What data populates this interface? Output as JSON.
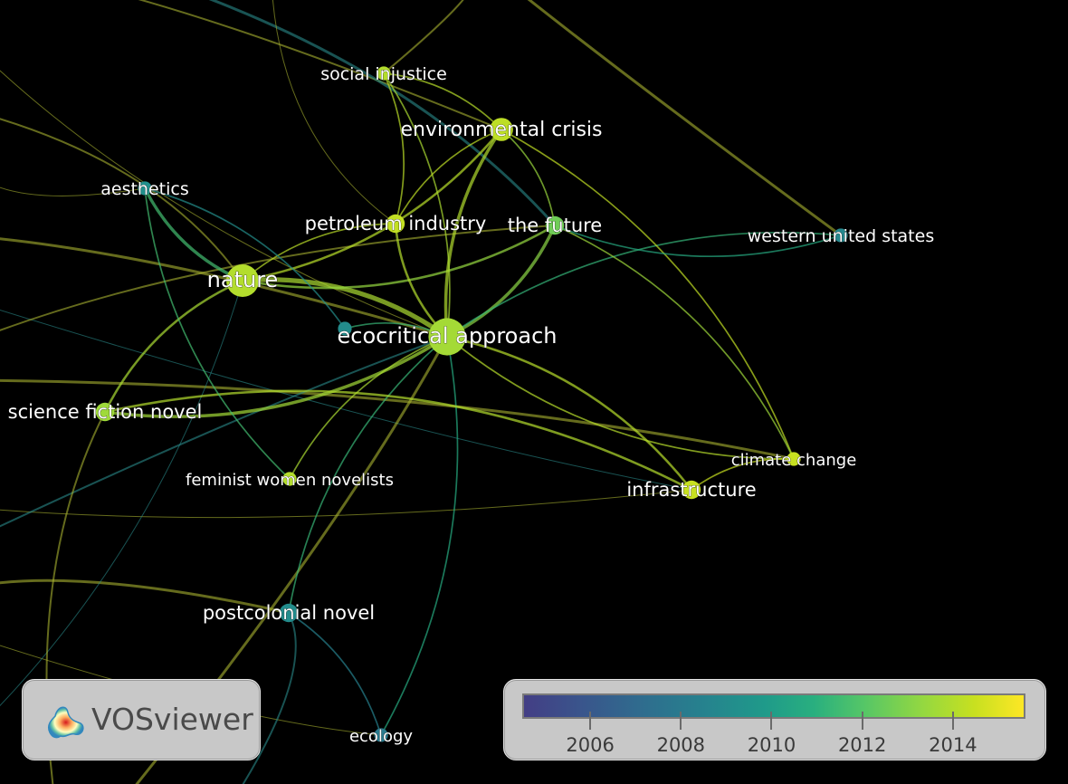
{
  "app": {
    "logo_text": "VOSviewer"
  },
  "network": {
    "nodes": [
      {
        "id": "social-injustice",
        "label": "social injustice",
        "year": 2014.6,
        "weight": 1
      },
      {
        "id": "environmental-crisis",
        "label": "environmental crisis",
        "year": 2014.8,
        "weight": 3
      },
      {
        "id": "aesthetics",
        "label": "aesthetics",
        "year": 2010.6,
        "weight": 1
      },
      {
        "id": "petroleum-industry",
        "label": "petroleum industry",
        "year": 2014.9,
        "weight": 2
      },
      {
        "id": "the-future",
        "label": "the future",
        "year": 2013.4,
        "weight": 2
      },
      {
        "id": "western-united-states",
        "label": "western united states",
        "year": 2010.2,
        "weight": 1
      },
      {
        "id": "nature",
        "label": "nature",
        "year": 2014.6,
        "weight": 5
      },
      {
        "id": "ecocritical-approach",
        "label": "ecocritical approach",
        "year": 2014.3,
        "weight": 6
      },
      {
        "id": "science-fiction-novel",
        "label": "science fiction novel",
        "year": 2014.2,
        "weight": 2
      },
      {
        "id": "feminist-women-novelists",
        "label": "feminist women novelists",
        "year": 2014.6,
        "weight": 1
      },
      {
        "id": "climate-change",
        "label": "climate change",
        "year": 2015.0,
        "weight": 1
      },
      {
        "id": "infrastructure",
        "label": "infrastructure",
        "year": 2015.0,
        "weight": 2
      },
      {
        "id": "postcolonial-novel",
        "label": "postcolonial novel",
        "year": 2010.4,
        "weight": 2
      },
      {
        "id": "ecology",
        "label": "ecology",
        "year": 2009.4,
        "weight": 1
      },
      {
        "id": "unlabeled-node",
        "label": "",
        "year": 2010.4,
        "weight": 1
      }
    ],
    "links": [
      [
        "nature",
        "ecocritical-approach",
        5
      ],
      [
        "nature",
        "environmental-crisis",
        2
      ],
      [
        "nature",
        "aesthetics",
        3
      ],
      [
        "nature",
        "the-future",
        2
      ],
      [
        "nature",
        "petroleum-industry",
        1
      ],
      [
        "nature",
        "science-fiction-novel",
        2
      ],
      [
        "ecocritical-approach",
        "environmental-crisis",
        3
      ],
      [
        "ecocritical-approach",
        "the-future",
        3
      ],
      [
        "ecocritical-approach",
        "petroleum-industry",
        2
      ],
      [
        "ecocritical-approach",
        "social-injustice",
        1
      ],
      [
        "ecocritical-approach",
        "science-fiction-novel",
        3
      ],
      [
        "ecocritical-approach",
        "feminist-women-novelists",
        1
      ],
      [
        "ecocritical-approach",
        "infrastructure",
        2
      ],
      [
        "ecocritical-approach",
        "climate-change",
        1
      ],
      [
        "ecocritical-approach",
        "western-united-states",
        1
      ],
      [
        "ecocritical-approach",
        "postcolonial-novel",
        1
      ],
      [
        "ecocritical-approach",
        "ecology",
        1
      ],
      [
        "ecocritical-approach",
        "unlabeled-node",
        1
      ],
      [
        "environmental-crisis",
        "climate-change",
        1
      ],
      [
        "environmental-crisis",
        "petroleum-industry",
        1
      ],
      [
        "environmental-crisis",
        "the-future",
        1
      ],
      [
        "environmental-crisis",
        "social-injustice",
        1
      ],
      [
        "the-future",
        "climate-change",
        1
      ],
      [
        "the-future",
        "western-united-states",
        1
      ],
      [
        "infrastructure",
        "climate-change",
        1
      ],
      [
        "infrastructure",
        "science-fiction-novel",
        2
      ],
      [
        "postcolonial-novel",
        "ecology",
        1
      ],
      [
        "aesthetics",
        "feminist-women-novelists",
        1
      ],
      [
        "aesthetics",
        "unlabeled-node",
        1
      ],
      [
        "petroleum-industry",
        "social-injustice",
        1
      ]
    ]
  },
  "legend": {
    "ticks": [
      "2006",
      "2008",
      "2010",
      "2012",
      "2014"
    ],
    "scale_min": 2004.5,
    "scale_max": 2015.6,
    "colors": {
      "start": "#433e85",
      "mid": "#1f9a8a",
      "end": "#fde725"
    }
  }
}
